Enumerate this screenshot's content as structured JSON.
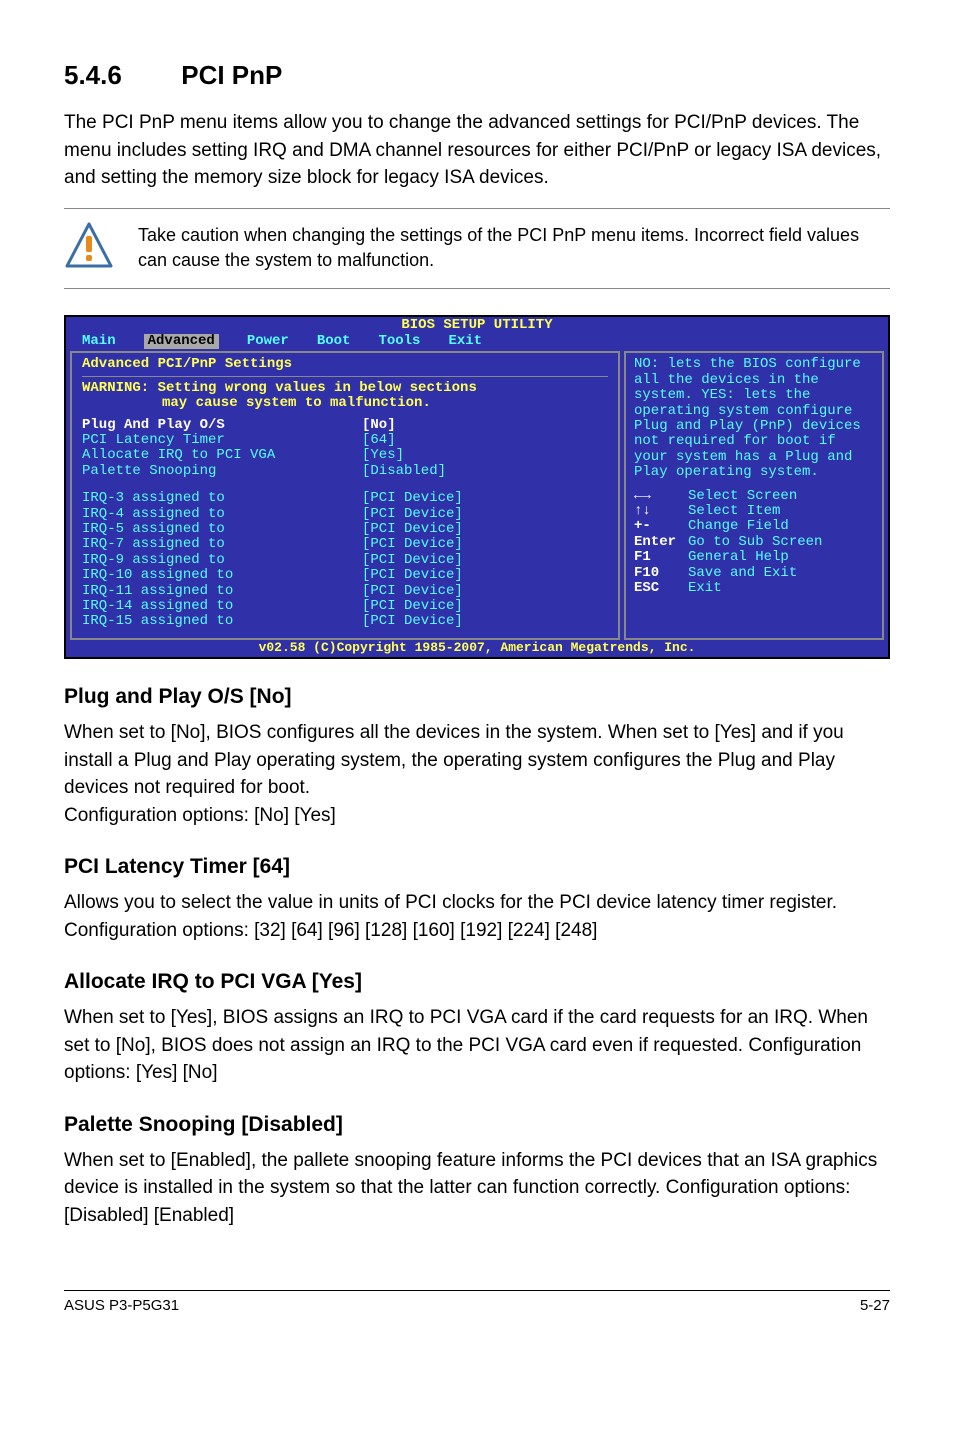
{
  "heading": {
    "number": "5.4.6",
    "title": "PCI PnP"
  },
  "intro": "The PCI PnP menu items allow you to change the advanced settings for PCI/PnP devices. The menu includes setting IRQ and DMA channel resources for either PCI/PnP or legacy ISA devices, and setting the memory size block for legacy ISA devices.",
  "callout": "Take caution when changing the settings of the PCI PnP menu items. Incorrect field values can cause the system to malfunction.",
  "bios": {
    "title": "BIOS SETUP UTILITY",
    "menu": [
      "Main",
      "Advanced",
      "Power",
      "Boot",
      "Tools",
      "Exit"
    ],
    "panel_title": "Advanced PCI/PnP Settings",
    "warning_line1": "WARNING: Setting wrong values in below sections",
    "warning_line2": "may cause system to malfunction.",
    "items": [
      {
        "label": "Plug And Play O/S",
        "value": "[No]",
        "hl": true
      },
      {
        "label": "PCI Latency Timer",
        "value": "[64]",
        "hl": false
      },
      {
        "label": "Allocate IRQ to PCI VGA",
        "value": "[Yes]",
        "hl": false
      },
      {
        "label": "Palette Snooping",
        "value": "[Disabled]",
        "hl": false
      },
      {
        "label": "",
        "value": "",
        "hl": false
      },
      {
        "label": "IRQ-3 assigned to",
        "value": "[PCI Device]",
        "hl": false
      },
      {
        "label": "IRQ-4 assigned to",
        "value": "[PCI Device]",
        "hl": false
      },
      {
        "label": "IRQ-5 assigned to",
        "value": "[PCI Device]",
        "hl": false
      },
      {
        "label": "IRQ-7 assigned to",
        "value": "[PCI Device]",
        "hl": false
      },
      {
        "label": "IRQ-9 assigned to",
        "value": "[PCI Device]",
        "hl": false
      },
      {
        "label": "IRQ-10 assigned to",
        "value": "[PCI Device]",
        "hl": false
      },
      {
        "label": "IRQ-11 assigned to",
        "value": "[PCI Device]",
        "hl": false
      },
      {
        "label": "IRQ-14 assigned to",
        "value": "[PCI Device]",
        "hl": false
      },
      {
        "label": "IRQ-15 assigned to",
        "value": "[PCI Device]",
        "hl": false
      }
    ],
    "help_text": "NO: lets the BIOS configure  all the devices in the system. YES: lets the operating system configure Plug and Play (PnP) devices not required for boot if your system has a Plug and Play operating system.",
    "nav": [
      {
        "key": "←→",
        "label": "Select Screen"
      },
      {
        "key": "↑↓",
        "label": "Select Item"
      },
      {
        "key": "+-",
        "label": "Change Field"
      },
      {
        "key": "Enter",
        "label": "Go to Sub Screen"
      },
      {
        "key": "F1",
        "label": "General Help"
      },
      {
        "key": "F10",
        "label": "Save and Exit"
      },
      {
        "key": "ESC",
        "label": "Exit"
      }
    ],
    "footer": "v02.58 (C)Copyright 1985-2007, American Megatrends, Inc."
  },
  "sections": [
    {
      "title": "Plug and Play O/S [No]",
      "body": "When set to [No], BIOS configures all the devices in the system. When set to [Yes] and if you install a Plug and Play operating system, the operating system configures the Plug and Play devices not required for boot.\nConfiguration options: [No] [Yes]"
    },
    {
      "title": "PCI Latency Timer [64]",
      "body": "Allows you to select the value in units of PCI clocks for the PCI device latency timer register. Configuration options: [32] [64] [96] [128] [160] [192] [224] [248]"
    },
    {
      "title": "Allocate IRQ to PCI VGA [Yes]",
      "body": "When set to [Yes], BIOS assigns an IRQ to PCI VGA card if the card requests for an IRQ. When set to [No], BIOS does not assign an IRQ to the PCI VGA card even if requested. Configuration options: [Yes] [No]"
    },
    {
      "title": "Palette Snooping [Disabled]",
      "body": "When set to [Enabled], the pallete snooping feature informs the PCI devices that an ISA graphics device is installed in the system so that the latter can function correctly. Configuration options: [Disabled] [Enabled]"
    }
  ],
  "footer": {
    "left": "ASUS P3-P5G31",
    "right": "5-27"
  }
}
